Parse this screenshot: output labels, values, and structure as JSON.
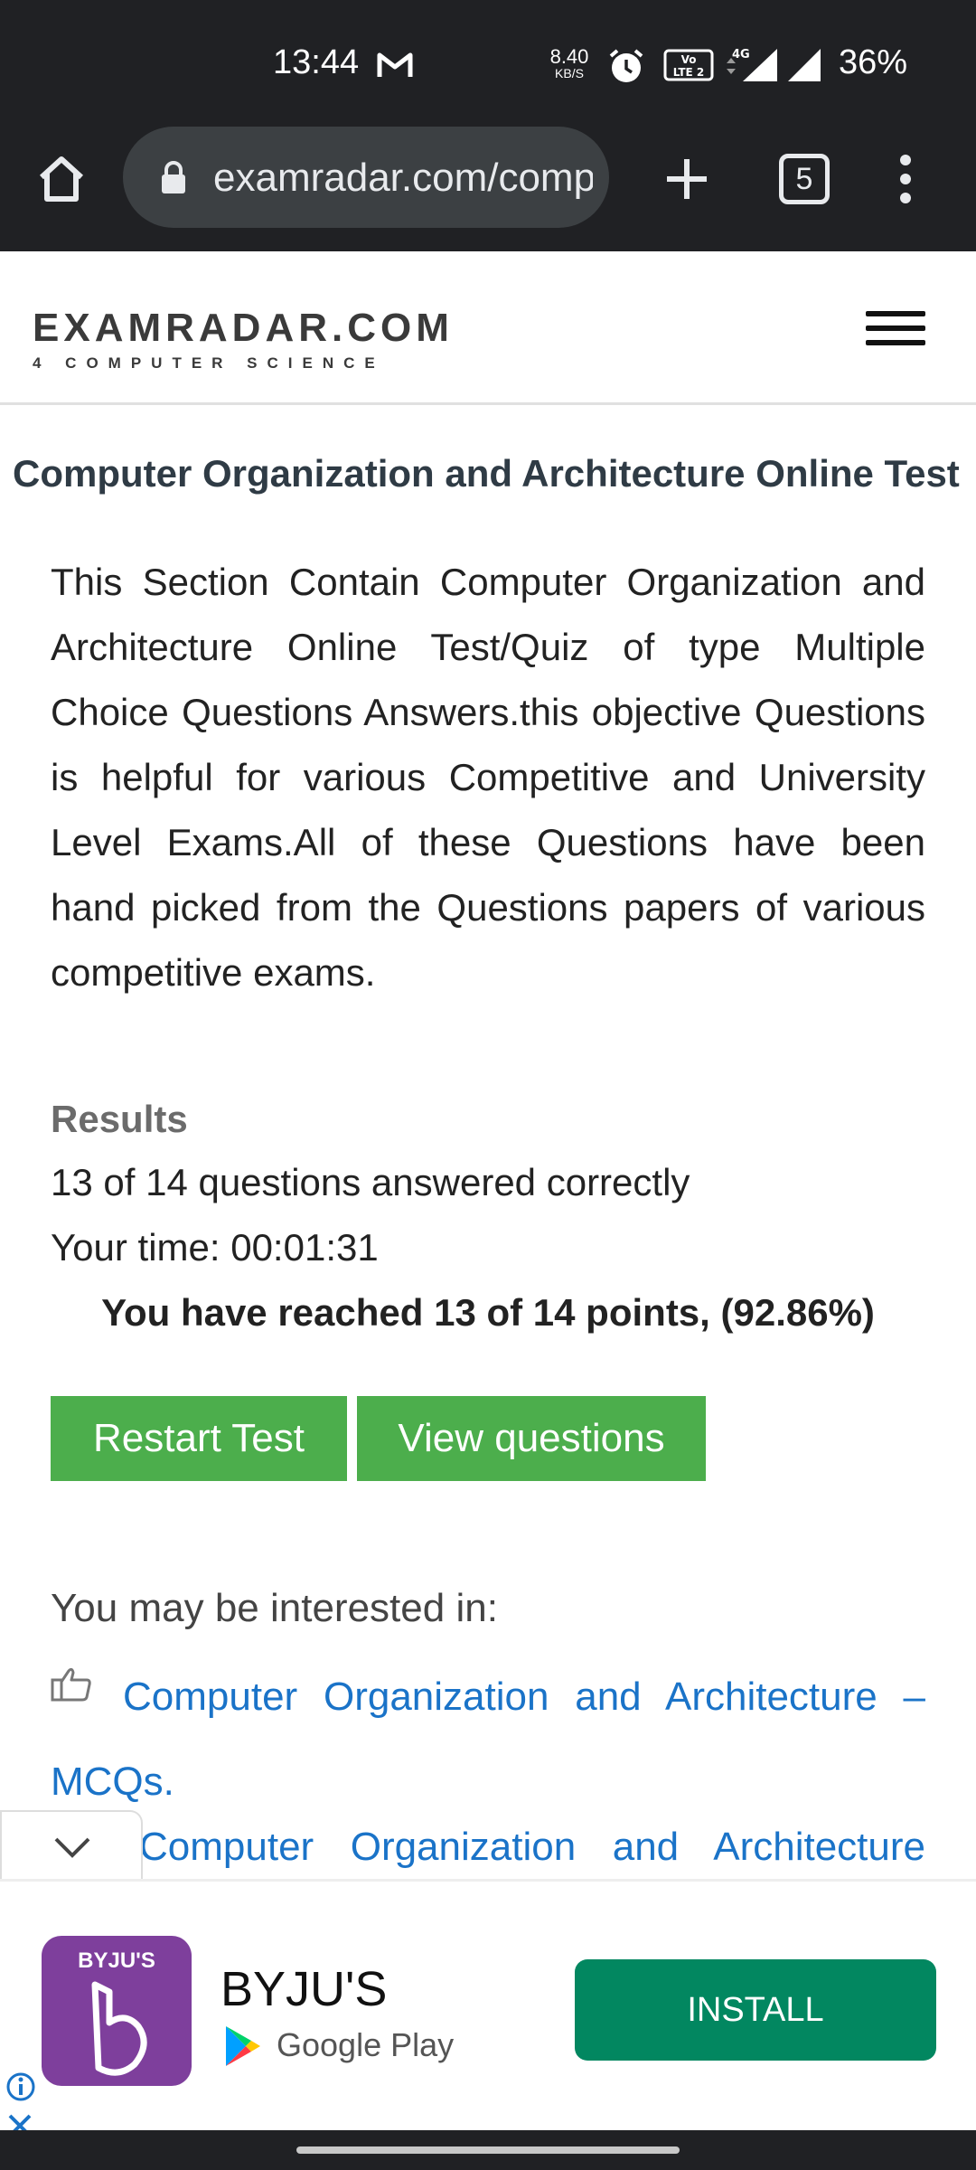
{
  "status_bar": {
    "time": "13:44",
    "net_speed_value": "8.40",
    "net_speed_unit": "KB/S",
    "battery": "36%",
    "icons": [
      "gmail-icon",
      "alarm-icon",
      "volte-icon",
      "signal-4g-icon",
      "signal-icon"
    ]
  },
  "browser": {
    "url": "examradar.com/computer-organization-and-architecture-online-test",
    "tab_count": "5",
    "icons": [
      "home-icon",
      "lock-icon",
      "new-tab-icon",
      "tabs-icon",
      "more-menu-icon"
    ]
  },
  "site": {
    "logo_main": "EXAMRADAR.COM",
    "logo_sub": "4 COMPUTER SCIENCE"
  },
  "page": {
    "title": "Computer Organization and Architecture Online Test",
    "intro": "This Section Contain Computer Organization and Architecture Online Test/Quiz of type Multiple Choice Questions Answers.this objective Questions is helpful for various Competitive and University Level Exams.All of these Questions have been hand picked from the Questions papers of various competitive exams."
  },
  "results": {
    "heading": "Results",
    "correct_text": "13 of 14 questions answered correctly",
    "time_text": "Your time: 00:01:31",
    "points_text": "You have reached 13 of 14 points, (92.86%)",
    "correct": 13,
    "total": 14,
    "percent": 92.86
  },
  "buttons": {
    "restart": "Restart Test",
    "view": "View questions"
  },
  "related": {
    "heading": "You may be interested in:",
    "links": [
      "Computer Organization and Architecture – MCQs.",
      "Computer Organization and Architecture"
    ]
  },
  "ad": {
    "logo_text": "BYJU'S",
    "name": "BYJU'S",
    "store": "Google Play",
    "install": "INSTALL",
    "brand_color": "#7e3f9c",
    "install_color": "#028760"
  },
  "colors": {
    "button_green": "#4cae4c",
    "link_blue": "#1a73c8",
    "chrome_dark": "#202124"
  }
}
